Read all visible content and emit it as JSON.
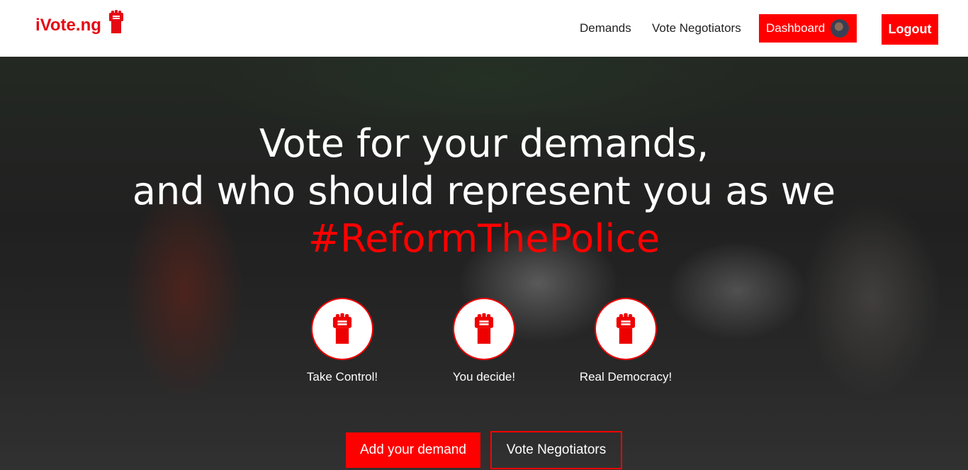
{
  "navbar": {
    "brand": "iVote.ng",
    "links": [
      "Demands",
      "Vote Negotiators"
    ],
    "dashboard_label": "Dashboard",
    "logout_label": "Logout"
  },
  "hero": {
    "title_line1": "Vote for your demands,",
    "title_line2": "and who should represent you as we",
    "hashtag": "#ReformThePolice",
    "features": [
      "Take Control!",
      "You decide!",
      "Real Democracy!"
    ],
    "primary_button": "Add your demand",
    "secondary_button": "Vote Negotiators"
  },
  "colors": {
    "accent": "#ff0000",
    "brand": "#e50914"
  },
  "icons": {
    "brand": "raised-fist-icon",
    "features": "raised-fist-icon",
    "avatar": "user-avatar"
  }
}
